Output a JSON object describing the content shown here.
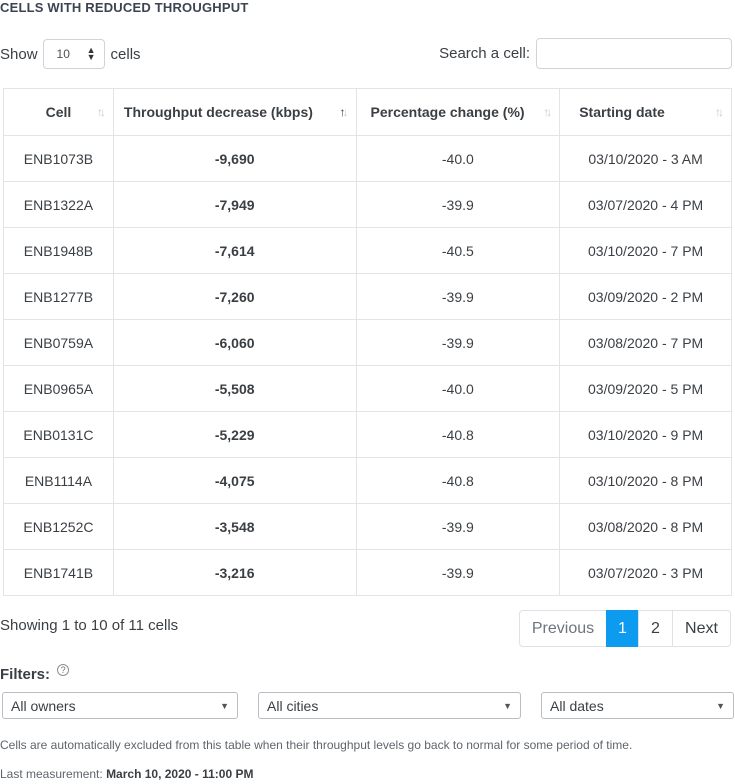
{
  "title": "CELLS WITH REDUCED THROUGHPUT",
  "controls": {
    "show_label": "Show",
    "page_size": "10",
    "cells_label": "cells",
    "search_label": "Search a cell:",
    "search_value": ""
  },
  "table": {
    "headers": [
      "Cell",
      "Throughput decrease (kbps)",
      "Percentage change (%)",
      "Starting date"
    ],
    "sorted_column": "Throughput decrease (kbps)",
    "rows": [
      {
        "cell": "ENB1073B",
        "decrease": "-9,690",
        "pct": "-40.0",
        "date": "03/10/2020 - 3 AM"
      },
      {
        "cell": "ENB1322A",
        "decrease": "-7,949",
        "pct": "-39.9",
        "date": "03/07/2020 - 4 PM"
      },
      {
        "cell": "ENB1948B",
        "decrease": "-7,614",
        "pct": "-40.5",
        "date": "03/10/2020 - 7 PM"
      },
      {
        "cell": "ENB1277B",
        "decrease": "-7,260",
        "pct": "-39.9",
        "date": "03/09/2020 - 2 PM"
      },
      {
        "cell": "ENB0759A",
        "decrease": "-6,060",
        "pct": "-39.9",
        "date": "03/08/2020 - 7 PM"
      },
      {
        "cell": "ENB0965A",
        "decrease": "-5,508",
        "pct": "-40.0",
        "date": "03/09/2020 - 5 PM"
      },
      {
        "cell": "ENB0131C",
        "decrease": "-5,229",
        "pct": "-40.8",
        "date": "03/10/2020 - 9 PM"
      },
      {
        "cell": "ENB1114A",
        "decrease": "-4,075",
        "pct": "-40.8",
        "date": "03/10/2020 - 8 PM"
      },
      {
        "cell": "ENB1252C",
        "decrease": "-3,548",
        "pct": "-39.9",
        "date": "03/08/2020 - 8 PM"
      },
      {
        "cell": "ENB1741B",
        "decrease": "-3,216",
        "pct": "-39.9",
        "date": "03/07/2020 - 3 PM"
      }
    ]
  },
  "pagination": {
    "summary": "Showing 1 to 10 of 11 cells",
    "previous": "Previous",
    "pages": [
      "1",
      "2"
    ],
    "current_page": "1",
    "next": "Next"
  },
  "filters": {
    "title": "Filters:",
    "owners": "All owners",
    "cities": "All cities",
    "dates": "All dates"
  },
  "footer": {
    "note": "Cells are automatically excluded from this table when their throughput levels go back to normal for some period of time.",
    "last_measurement_label": "Last measurement:",
    "last_measurement_value": "March 10, 2020 - 11:00 PM"
  },
  "colors": {
    "link": "#1f7ed6",
    "active_page": "#0d9bf0"
  },
  "icons": {
    "sort": "sort-arrows-icon",
    "help": "help-circle-icon",
    "caret": "caret-down-icon"
  }
}
